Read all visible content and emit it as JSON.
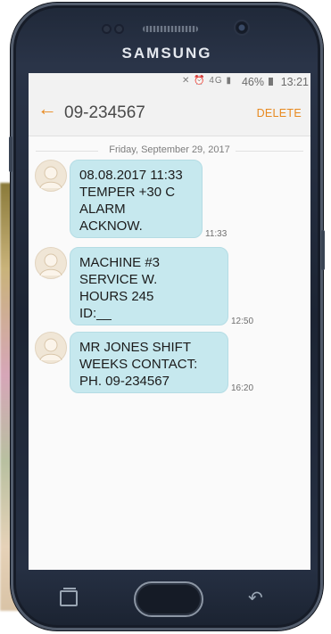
{
  "device": {
    "brand": "SAMSUNG"
  },
  "status_bar": {
    "icons": "✕ ⏰ 4G ▮",
    "battery": "46%",
    "time": "13:21"
  },
  "app_bar": {
    "title": "09-234567",
    "delete_label": "DELETE"
  },
  "conversation": {
    "date": "Friday, September 29, 2017",
    "messages": [
      {
        "lines": [
          "08.08.2017 11:33",
          "TEMPER +30 C",
          "ALARM",
          "ACKNOW."
        ],
        "time": "11:33"
      },
      {
        "lines": [
          "MACHINE #3",
          "SERVICE W.",
          "HOURS 245",
          "ID:__"
        ],
        "time": "12:50"
      },
      {
        "lines": [
          "MR JONES SHIFT",
          "WEEKS CONTACT:",
          "PH. 09-234567"
        ],
        "time": "16:20"
      }
    ]
  }
}
